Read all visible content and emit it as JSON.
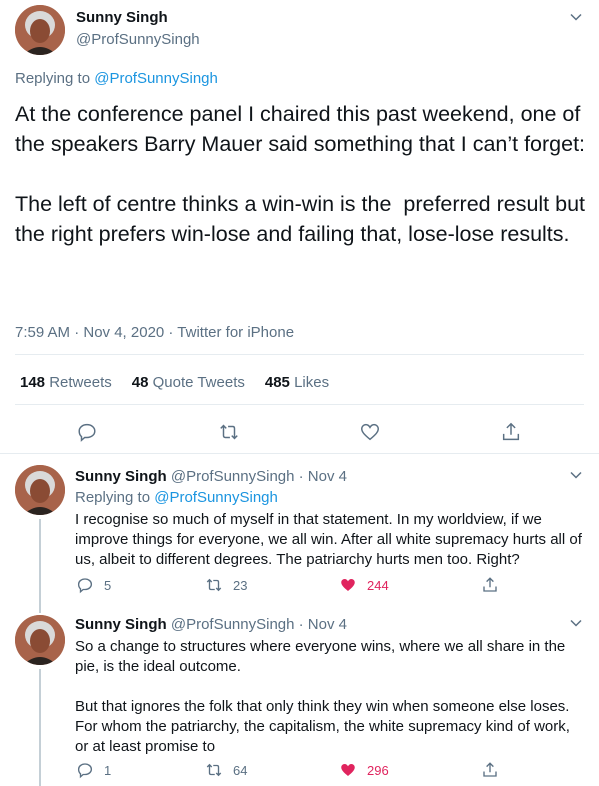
{
  "main_tweet": {
    "name": "Sunny Singh",
    "handle": "@ProfSunnySingh",
    "replying_to_prefix": "Replying to ",
    "replying_to_handle": "@ProfSunnySingh",
    "text": "At the conference panel I chaired this past weekend, one of the speakers Barry Mauer said something that I can’t forget:\n\nThe left of centre thinks a win-win is the  preferred result but the right prefers win-lose and failing that, lose-lose results.",
    "timestamp": "7:59 AM · Nov 4, 2020 · Twitter for iPhone",
    "retweets_count": "148",
    "retweets_label": "Retweets",
    "quote_tweets_count": "48",
    "quote_tweets_label": "Quote Tweets",
    "likes_count": "485",
    "likes_label": "Likes"
  },
  "replies": [
    {
      "name": "Sunny Singh",
      "handle_date": "@ProfSunnySingh · Nov 4",
      "replying_to_prefix": "Replying to ",
      "replying_to_handle": "@ProfSunnySingh",
      "text": "I recognise so much of myself in that statement. In my worldview, if we improve things for everyone, we all win. After all white supremacy hurts all of us, albeit to different degrees. The patriarchy hurts men too. Right?",
      "reply_count": "5",
      "retweet_count": "23",
      "like_count": "244"
    },
    {
      "name": "Sunny Singh",
      "handle_date": "@ProfSunnySingh · Nov 4",
      "text": "So a change to structures where everyone wins, where we all share in the pie, is the ideal outcome.\n\nBut that ignores the folk that only think they win when someone else loses. For whom the patriarchy, the capitalism, the white supremacy kind of work, or at least promise to",
      "reply_count": "1",
      "retweet_count": "64",
      "like_count": "296"
    }
  ],
  "icons": [
    "reply-icon",
    "retweet-icon",
    "like-icon",
    "share-icon",
    "chevron-down-icon"
  ],
  "colors": {
    "accent": "#1b95e0",
    "secondary_text": "#5b7083",
    "like": "#e0245e",
    "border": "#e6ecf0"
  }
}
